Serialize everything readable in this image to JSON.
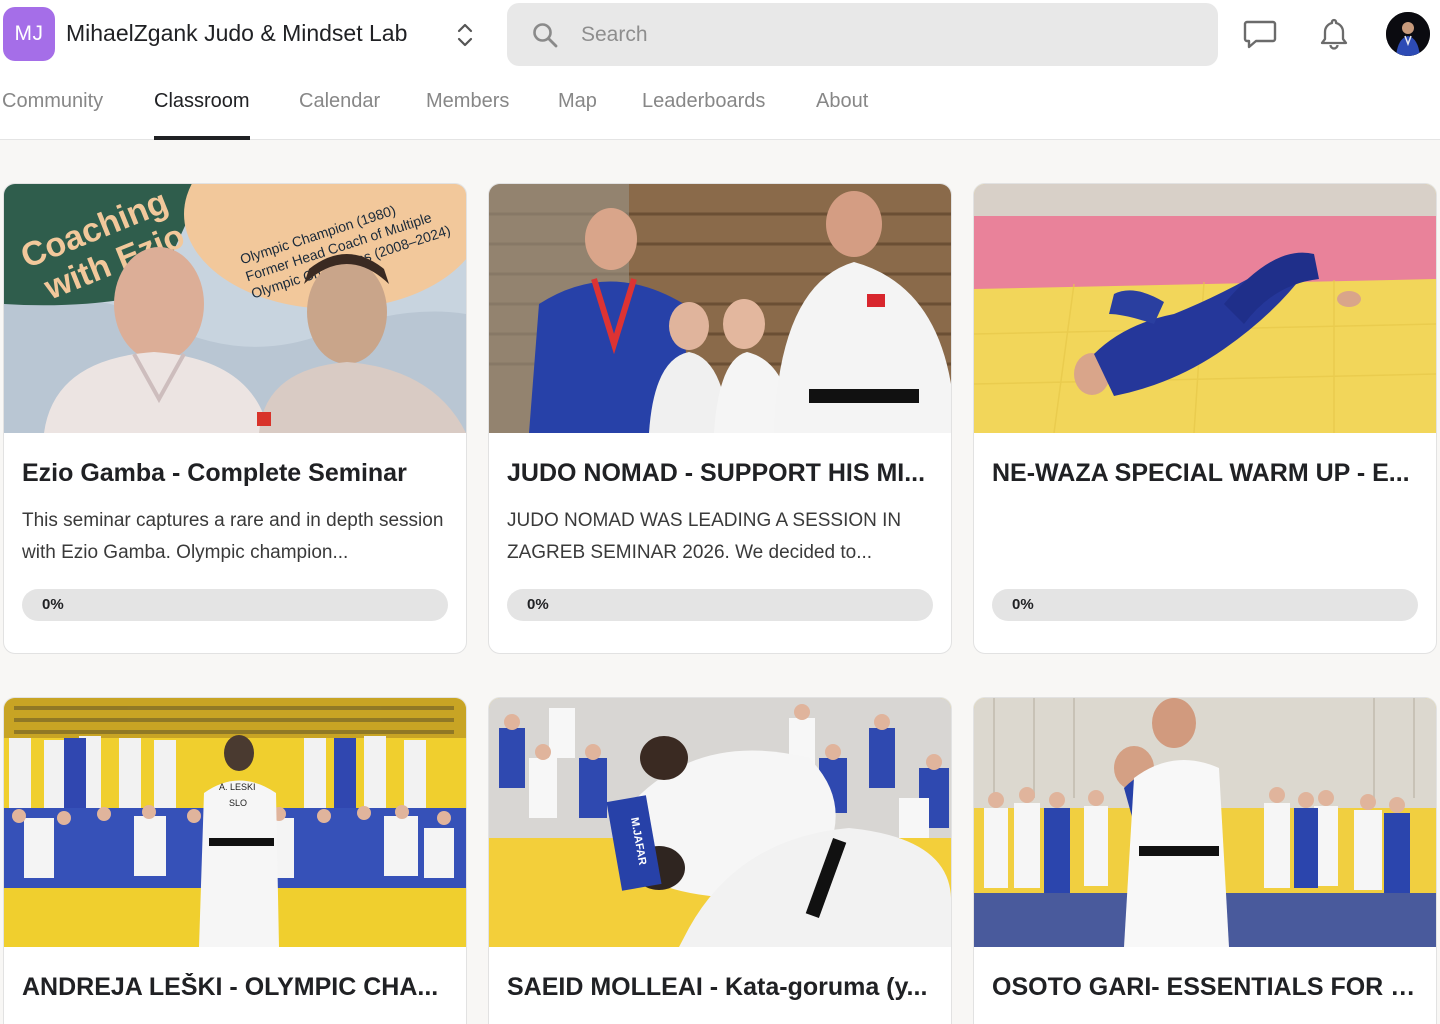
{
  "header": {
    "logo_initials": "MJ",
    "group_name": "MihaelZgank Judo & Mindset Lab",
    "search_placeholder": "Search"
  },
  "tabs": [
    {
      "label": "Community",
      "active": false
    },
    {
      "label": "Classroom",
      "active": true
    },
    {
      "label": "Calendar",
      "active": false
    },
    {
      "label": "Members",
      "active": false
    },
    {
      "label": "Map",
      "active": false
    },
    {
      "label": "Leaderboards",
      "active": false
    },
    {
      "label": "About",
      "active": false
    }
  ],
  "courses": [
    {
      "title": "Ezio Gamba - Complete Seminar",
      "description": "This seminar captures a rare and in depth session with Ezio Gamba. Olympic champion...",
      "progress_label": "0%",
      "progress": 0,
      "thumb_text": {
        "headline_1": "Coaching",
        "headline_2": "with Ezio Gamba",
        "line_1": "Olympic Champion (1980)",
        "line_2": "Former Head Coach of Multiple",
        "line_3": "Olympic Champions (2008–2024)"
      }
    },
    {
      "title": "JUDO NOMAD - SUPPORT HIS MI...",
      "description": "JUDO NOMAD WAS LEADING A SESSION IN ZAGREB SEMINAR 2026. We decided to...",
      "progress_label": "0%",
      "progress": 0
    },
    {
      "title": "NE-WAZA SPECIAL WARM UP - E...",
      "description": "",
      "progress_label": "0%",
      "progress": 0
    },
    {
      "title": "ANDREJA LEŠKI - OLYMPIC CHA...",
      "description": "",
      "thumb_text": {
        "back_name": "A. LESKI",
        "back_country": "SLO"
      }
    },
    {
      "title": "SAEID MOLLEAI - Kata-goruma (y...",
      "description": "",
      "thumb_text": {
        "back_name": "M.JAFAR"
      }
    },
    {
      "title": "OSOTO GARI- ESSENTIALS FOR K...",
      "description": ""
    }
  ],
  "colors": {
    "accent": "#a56ee8",
    "mat_yellow": "#f2d65a",
    "mat_red": "#e9829a",
    "gi_blue": "#2a3fa0"
  }
}
